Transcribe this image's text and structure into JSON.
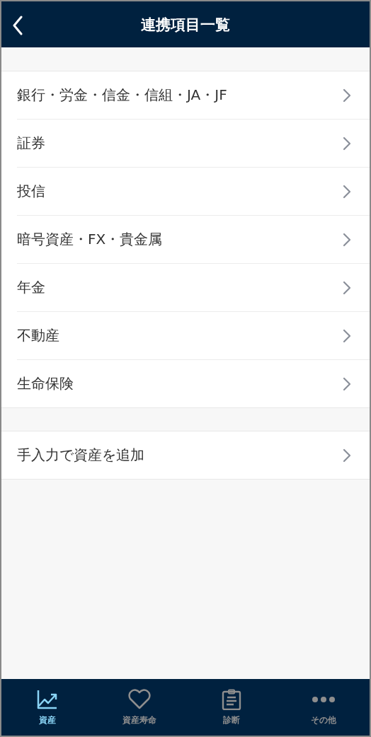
{
  "header": {
    "title": "連携項目一覧"
  },
  "sections": [
    {
      "items": [
        "銀行・労金・信金・信組・JA・JF",
        "証券",
        "投信",
        "暗号資産・FX・貴金属",
        "年金",
        "不動産",
        "生命保険"
      ]
    },
    {
      "items": [
        "手入力で資産を追加"
      ]
    }
  ],
  "tabs": [
    {
      "label": "資産",
      "kind": "chart",
      "selected": true
    },
    {
      "label": "資産寿命",
      "kind": "heart",
      "selected": false
    },
    {
      "label": "診断",
      "kind": "clipboard",
      "selected": false
    },
    {
      "label": "その他",
      "kind": "more",
      "selected": false
    }
  ]
}
